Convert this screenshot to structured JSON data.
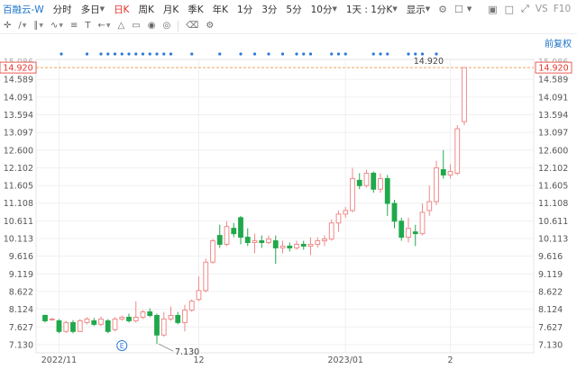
{
  "toolbar": {
    "stock_name": "百融云-W",
    "periods": [
      {
        "label": "分时",
        "active": false
      },
      {
        "label": "多日",
        "active": false,
        "caret": true
      },
      {
        "label": "日K",
        "active": true
      },
      {
        "label": "周K",
        "active": false
      },
      {
        "label": "月K",
        "active": false
      },
      {
        "label": "季K",
        "active": false
      },
      {
        "label": "年K",
        "active": false
      },
      {
        "label": "1分",
        "active": false
      },
      {
        "label": "3分",
        "active": false
      },
      {
        "label": "5分",
        "active": false
      },
      {
        "label": "10分",
        "active": false,
        "caret": true
      },
      {
        "label": "1天 : 1分K",
        "active": false,
        "caret": true
      }
    ],
    "display_label": "显示",
    "vs_label": "VS",
    "f10_label": "F10"
  },
  "drawing_tools": [
    {
      "icon": "move-cross-icon"
    },
    {
      "icon": "line-tool-icon",
      "caret": true
    },
    {
      "icon": "parallel-line-icon",
      "caret": true
    },
    {
      "icon": "wave-tool-icon",
      "caret": true
    },
    {
      "icon": "fibonacci-icon"
    },
    {
      "icon": "text-tool-icon"
    },
    {
      "icon": "arrow-tool-icon",
      "caret": true
    },
    {
      "icon": "measure-icon"
    },
    {
      "icon": "ruler-icon"
    },
    {
      "icon": "eye-icon"
    },
    {
      "icon": "record-icon"
    },
    {
      "icon": "delete-icon"
    },
    {
      "icon": "settings-icon"
    }
  ],
  "adjust_label": "前复权",
  "price_tag": "14.920",
  "last_price_label": "14.920",
  "low_price_label": "7.130",
  "event_marker": "E",
  "chart_data": {
    "type": "candlestick",
    "ylim": [
      6.9,
      15.15
    ],
    "y_ticks": [
      "14.920",
      "14.589",
      "14.091",
      "13.594",
      "13.097",
      "12.600",
      "12.102",
      "11.605",
      "11.108",
      "10.611",
      "10.113",
      "9.616",
      "9.119",
      "8.622",
      "8.124",
      "7.627",
      "7.130"
    ],
    "y_top_partial": "15.086",
    "x_ticks": [
      {
        "index": 2,
        "label": "2022/11"
      },
      {
        "index": 22,
        "label": "12"
      },
      {
        "index": 43,
        "label": "2023/01"
      },
      {
        "index": 58,
        "label": "2"
      }
    ],
    "up_color": "#f08a8a",
    "down_color": "#20a84c",
    "candles": [
      [
        7.95,
        7.8,
        7.98,
        7.75
      ],
      [
        7.85,
        7.85,
        7.88,
        7.8
      ],
      [
        7.8,
        7.5,
        7.85,
        7.45
      ],
      [
        7.5,
        7.75,
        7.8,
        7.45
      ],
      [
        7.75,
        7.5,
        7.82,
        7.45
      ],
      [
        7.5,
        7.8,
        7.85,
        7.48
      ],
      [
        7.75,
        7.85,
        7.9,
        7.7
      ],
      [
        7.8,
        7.7,
        7.88,
        7.65
      ],
      [
        7.7,
        7.85,
        7.92,
        7.65
      ],
      [
        7.8,
        7.5,
        7.85,
        7.45
      ],
      [
        7.55,
        7.85,
        7.9,
        7.5
      ],
      [
        7.85,
        7.9,
        7.95,
        7.8
      ],
      [
        7.9,
        7.8,
        8.0,
        7.75
      ],
      [
        7.8,
        7.9,
        8.35,
        7.75
      ],
      [
        7.9,
        8.05,
        8.1,
        7.85
      ],
      [
        8.05,
        7.95,
        8.15,
        7.9
      ],
      [
        7.95,
        7.4,
        8.0,
        7.15
      ],
      [
        7.4,
        7.85,
        8.05,
        7.35
      ],
      [
        7.85,
        7.95,
        8.2,
        7.8
      ],
      [
        7.95,
        7.75,
        8.05,
        7.7
      ],
      [
        7.75,
        8.1,
        8.25,
        7.5
      ],
      [
        8.1,
        8.35,
        8.4,
        8.05
      ],
      [
        8.4,
        8.65,
        9.05,
        8.35
      ],
      [
        8.65,
        9.45,
        9.55,
        8.6
      ],
      [
        9.45,
        10.05,
        10.1,
        9.4
      ],
      [
        10.2,
        9.95,
        10.5,
        9.85
      ],
      [
        9.95,
        10.45,
        10.6,
        9.9
      ],
      [
        10.4,
        10.25,
        10.55,
        10.15
      ],
      [
        10.7,
        10.15,
        10.75,
        9.95
      ],
      [
        10.15,
        10.0,
        10.4,
        9.9
      ],
      [
        10.0,
        10.05,
        10.25,
        9.7
      ],
      [
        10.05,
        10.0,
        10.2,
        9.85
      ],
      [
        10.0,
        10.1,
        10.2,
        9.95
      ],
      [
        10.05,
        9.85,
        10.2,
        9.4
      ],
      [
        9.85,
        9.9,
        10.05,
        9.7
      ],
      [
        9.9,
        9.85,
        10.0,
        9.75
      ],
      [
        9.85,
        9.95,
        10.05,
        9.8
      ],
      [
        9.95,
        9.9,
        10.05,
        9.8
      ],
      [
        9.9,
        9.95,
        10.15,
        9.65
      ],
      [
        9.95,
        10.05,
        10.15,
        9.85
      ],
      [
        10.05,
        10.1,
        10.2,
        9.9
      ],
      [
        10.1,
        10.55,
        10.65,
        10.05
      ],
      [
        10.55,
        10.8,
        10.9,
        10.3
      ],
      [
        10.8,
        10.9,
        11.0,
        10.7
      ],
      [
        10.9,
        11.8,
        12.1,
        10.85
      ],
      [
        11.75,
        11.6,
        11.95,
        11.5
      ],
      [
        11.6,
        11.95,
        12.05,
        11.55
      ],
      [
        11.95,
        11.5,
        12.0,
        11.4
      ],
      [
        11.5,
        11.8,
        11.95,
        11.4
      ],
      [
        11.8,
        11.1,
        11.9,
        10.75
      ],
      [
        11.1,
        10.6,
        11.2,
        10.4
      ],
      [
        10.6,
        10.15,
        10.7,
        10.05
      ],
      [
        10.15,
        10.4,
        10.7,
        10.0
      ],
      [
        10.3,
        10.25,
        10.5,
        9.9
      ],
      [
        10.25,
        10.85,
        11.1,
        10.2
      ],
      [
        10.9,
        11.15,
        11.6,
        10.75
      ],
      [
        11.15,
        12.1,
        12.3,
        11.05
      ],
      [
        12.05,
        11.9,
        12.6,
        11.8
      ],
      [
        11.9,
        12.0,
        12.2,
        11.8
      ],
      [
        11.95,
        13.2,
        13.3,
        11.9
      ],
      [
        13.4,
        14.92,
        14.92,
        13.3
      ]
    ]
  }
}
